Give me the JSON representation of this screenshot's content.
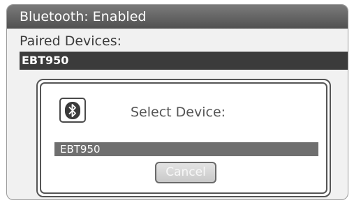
{
  "title_bar": {
    "text": "Bluetooth: Enabled"
  },
  "paired": {
    "label": "Paired Devices:",
    "devices": [
      "EBT950"
    ]
  },
  "dialog": {
    "icon": "bluetooth-icon",
    "title": "Select Device:",
    "device_list": [
      "EBT950"
    ],
    "cancel_label": "Cancel"
  },
  "colors": {
    "title_bar": "#5f5f5f",
    "selected_row": "#3b3b3b",
    "dialog_row": "#6f6f6f",
    "background": "#f1f1f1"
  }
}
